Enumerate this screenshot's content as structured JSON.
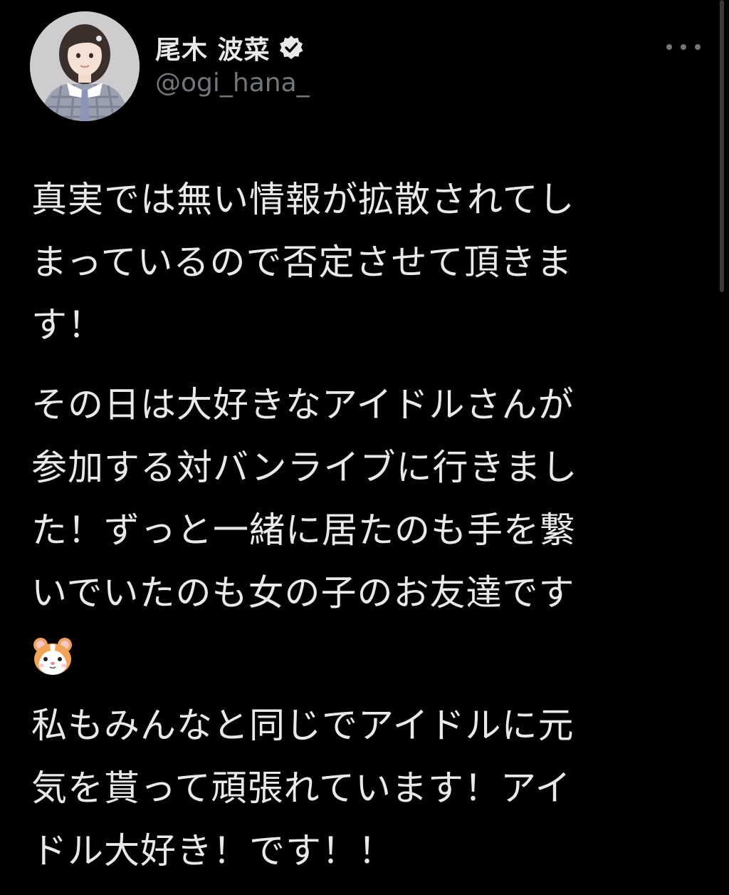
{
  "tweet": {
    "author": {
      "display_name": "尾木 波菜",
      "handle": "@ogi_hana_",
      "verified_icon": "verified-badge-icon",
      "avatar": "profile-photo"
    },
    "more_icon": "more-horizontal-icon",
    "paragraphs": [
      {
        "lines": [
          "真実では無い情報が拡散されてし",
          "まっているので否定させて頂きま",
          "す！"
        ]
      },
      {
        "lines": [
          "その日は大好きなアイドルさんが",
          "参加する対バンライブに行きまし",
          "た！ずっと一緒に居たのも手を繋",
          "いでいたのも女の子のお友達です"
        ],
        "trailing_emoji": "hamster-face-emoji"
      },
      {
        "lines": [
          "私もみんなと同じでアイドルに元",
          "気を貰って頑張れています！アイ",
          "ドル大好き！です！！"
        ]
      }
    ]
  },
  "colors": {
    "background": "#000000",
    "primary_text": "#e7e9ea",
    "secondary_text": "#71767b",
    "verified_badge": "#e7e9ea"
  }
}
